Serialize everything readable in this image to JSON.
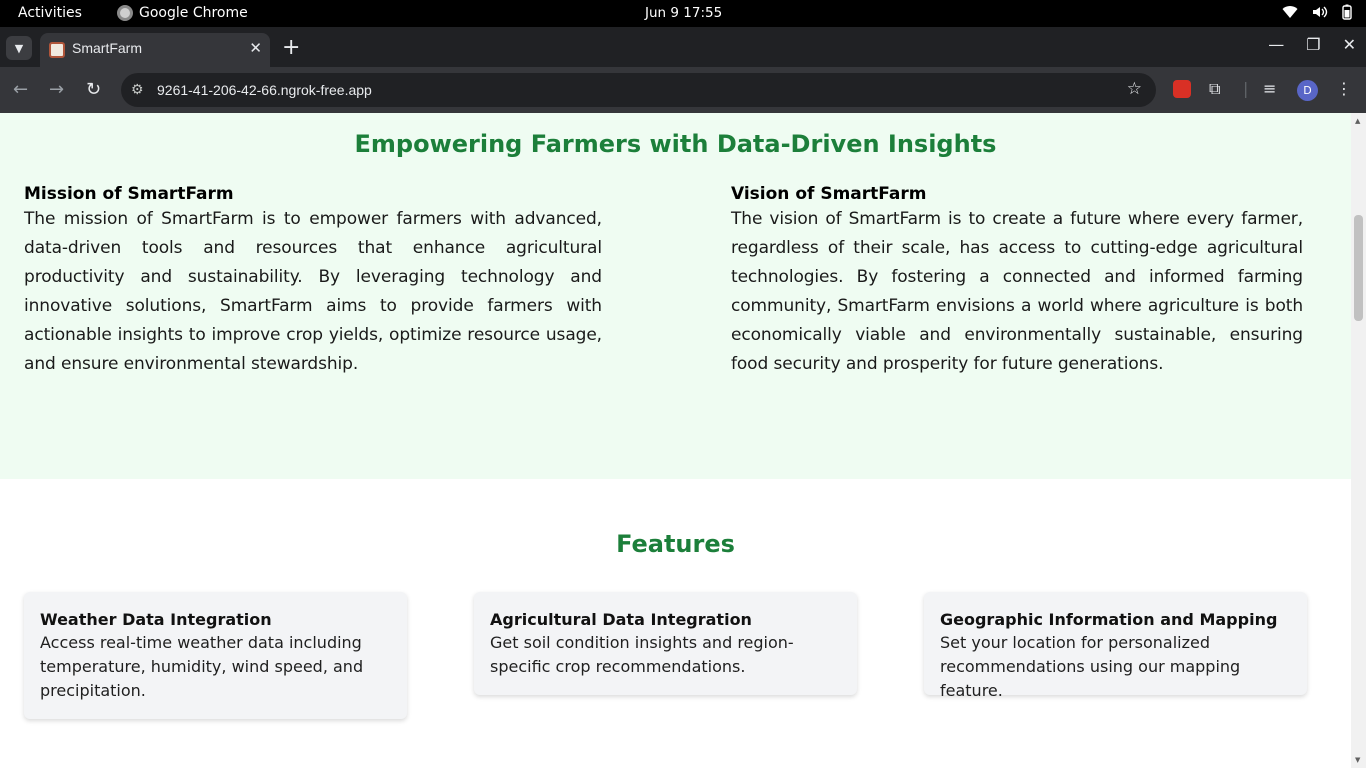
{
  "os": {
    "activities": "Activities",
    "app_name": "Google Chrome",
    "clock": "Jun 9  17:55"
  },
  "browser": {
    "tab_title": "SmartFarm",
    "url": "9261-41-206-42-66.ngrok-free.app",
    "avatar_letter": "D"
  },
  "page": {
    "about_heading": "Empowering Farmers with Data-Driven Insights",
    "mission": {
      "title": "Mission of SmartFarm",
      "text": "The mission of SmartFarm is to empower farmers with advanced, data-driven tools and resources that enhance agricultural productivity and sustainability. By leveraging technology and innovative solutions, SmartFarm aims to provide farmers with actionable insights to improve crop yields, optimize resource usage, and ensure environmental stewardship."
    },
    "vision": {
      "title": "Vision of SmartFarm",
      "text": "The vision of SmartFarm is to create a future where every farmer, regardless of their scale, has access to cutting-edge agricultural technologies. By fostering a connected and informed farming community, SmartFarm envisions a world where agriculture is both economically viable and environmentally sustainable, ensuring food security and prosperity for future generations."
    },
    "features_heading": "Features",
    "features": [
      {
        "title": "Weather Data Integration",
        "text": "Access real-time weather data including temperature, humidity, wind speed, and precipitation."
      },
      {
        "title": "Agricultural Data Integration",
        "text": "Get soil condition insights and region-specific crop recommendations."
      },
      {
        "title": "Geographic Information and Mapping",
        "text": "Set your location for personalized recommendations using our mapping feature."
      }
    ]
  },
  "colors": {
    "accent_green": "#1c7f3a",
    "about_bg": "#effcf2"
  }
}
